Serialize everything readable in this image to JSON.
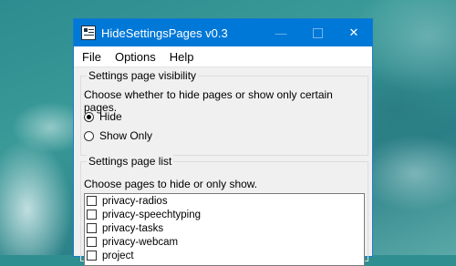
{
  "window": {
    "title": "HideSettingsPages v0.3",
    "controls": {
      "minimize": "—",
      "close": "✕"
    }
  },
  "menu": [
    "File",
    "Options",
    "Help"
  ],
  "visibility_group": {
    "title": "Settings page visibility",
    "description": "Choose whether to hide pages or show only certain pages.",
    "options": [
      {
        "label": "Hide",
        "selected": true
      },
      {
        "label": "Show Only",
        "selected": false
      }
    ]
  },
  "list_group": {
    "title": "Settings page list",
    "description": "Choose pages to hide or only show.",
    "items": [
      {
        "label": "privacy-radios",
        "checked": false
      },
      {
        "label": "privacy-speechtyping",
        "checked": false
      },
      {
        "label": "privacy-tasks",
        "checked": false
      },
      {
        "label": "privacy-webcam",
        "checked": false
      },
      {
        "label": "project",
        "checked": false
      }
    ]
  },
  "colors": {
    "titlebar": "#0078d7",
    "window_bg": "#f0f0f0"
  }
}
